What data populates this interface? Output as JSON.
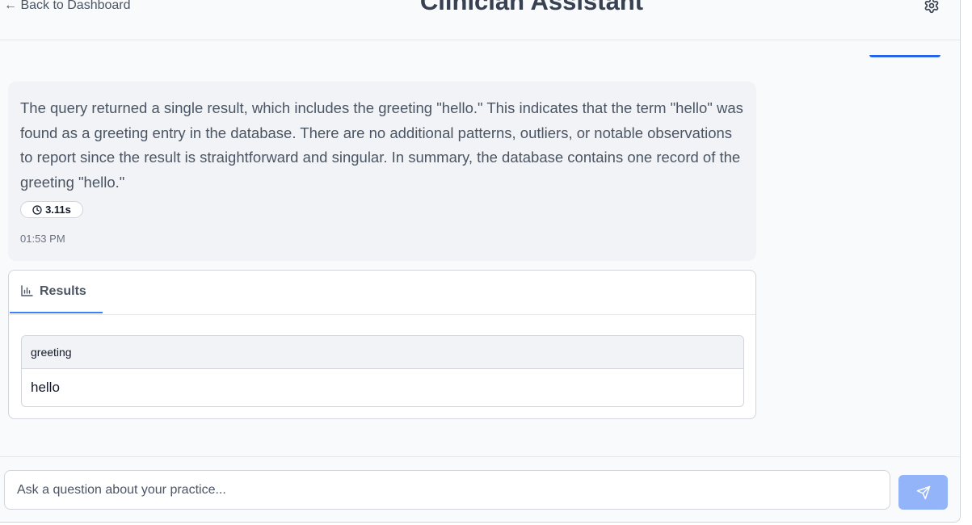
{
  "header": {
    "back_label": "← Back to Dashboard",
    "title": "Clinician Assistant",
    "settings_icon": "gear-icon"
  },
  "message": {
    "text": "The query returned a single result, which includes the greeting \"hello.\" This indicates that the term \"hello\" was found as a greeting entry in the database. There are no additional patterns, outliers, or notable observations to report since the result is straightforward and singular. In summary, the database contains one record of the greeting \"hello.\"",
    "duration": "3.11s",
    "timestamp": "01:53 PM",
    "clock_icon": "clock-icon"
  },
  "results": {
    "tab_label": "Results",
    "tab_icon": "bar-chart-icon",
    "columns": [
      "greeting"
    ],
    "rows": [
      [
        "hello"
      ]
    ]
  },
  "composer": {
    "placeholder": "Ask a question about your practice...",
    "value": "",
    "send_icon": "send-icon"
  },
  "colors": {
    "accent": "#3b82f6",
    "send_button": "#93b4f8",
    "bubble": "#f1f3f6"
  }
}
